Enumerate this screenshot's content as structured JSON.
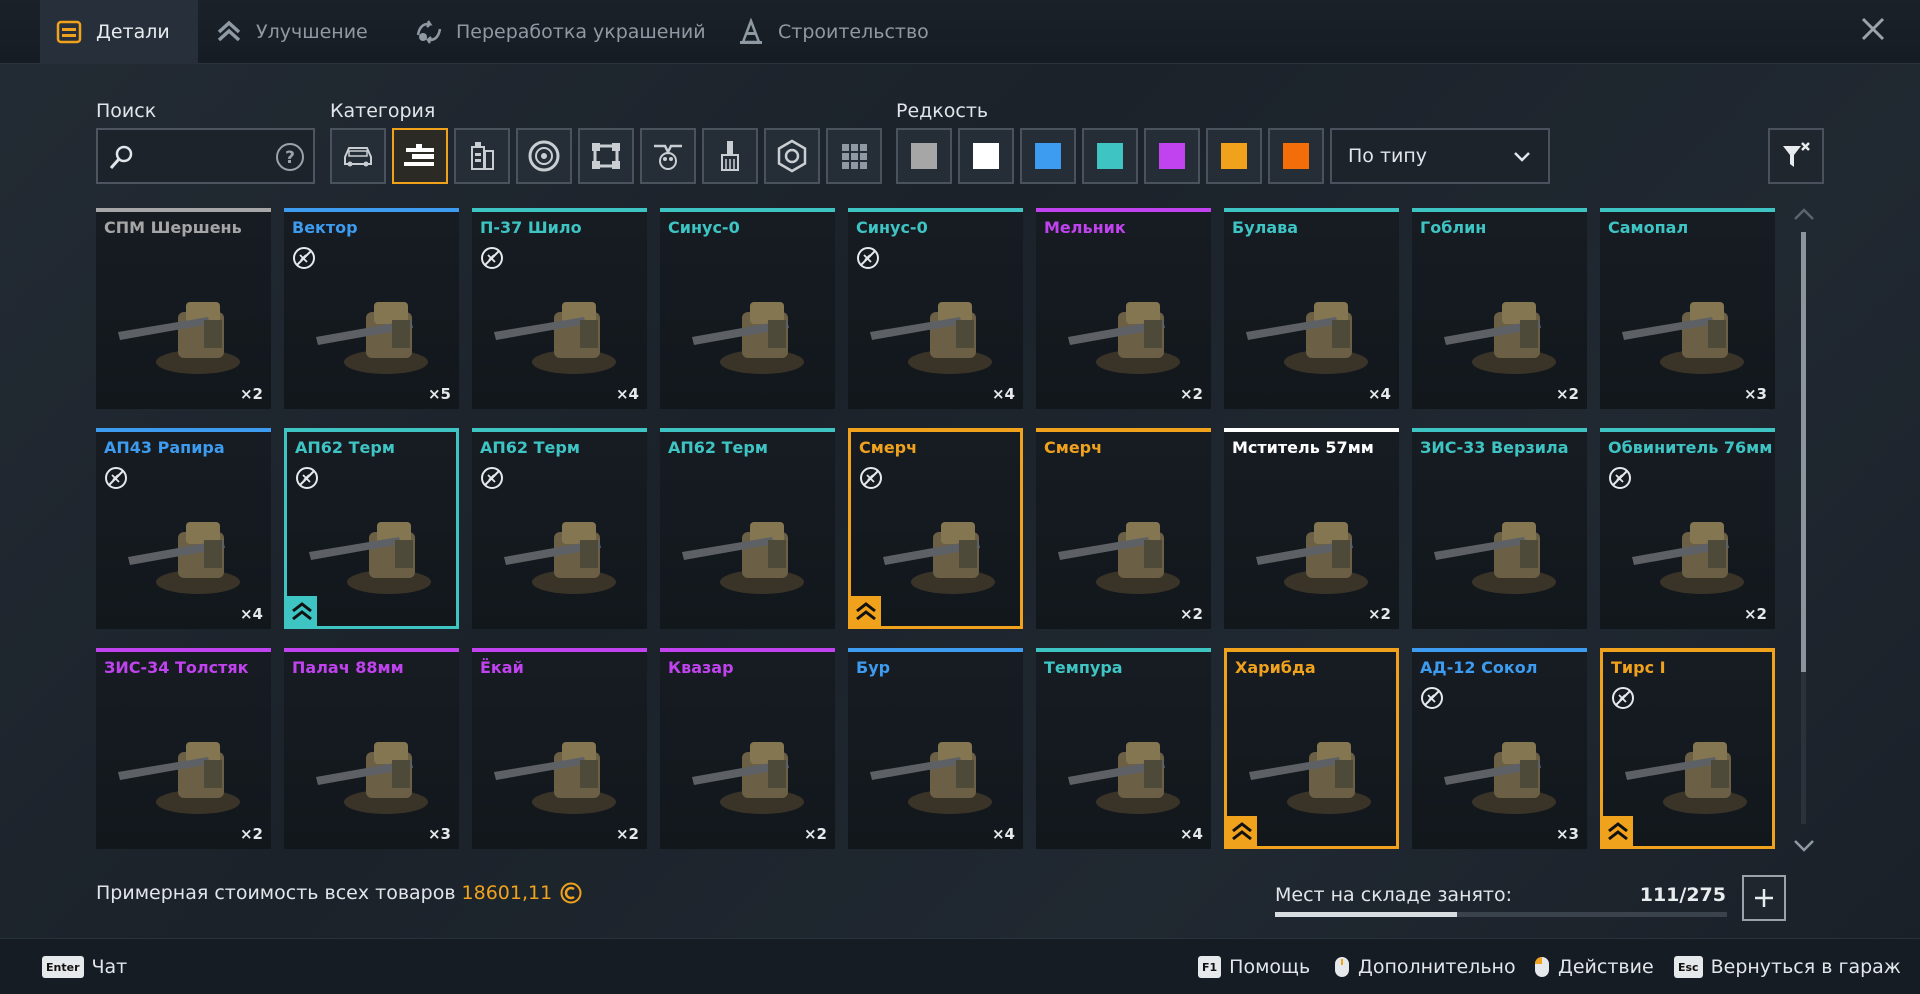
{
  "tabs": [
    {
      "label": "Детали",
      "icon": "parts-icon",
      "active": true
    },
    {
      "label": "Улучшение",
      "icon": "upgrade-icon",
      "active": false
    },
    {
      "label": "Переработка украшений",
      "icon": "recycle-icon",
      "active": false
    },
    {
      "label": "Строительство",
      "icon": "construction-icon",
      "active": false
    }
  ],
  "search": {
    "label": "Поиск",
    "value": "",
    "placeholder": ""
  },
  "category": {
    "label": "Категория",
    "buttons": [
      "cabins",
      "weapons",
      "modules",
      "movement",
      "frames",
      "decor",
      "paint",
      "structure",
      "all"
    ],
    "selected": "weapons"
  },
  "rarity": {
    "label": "Редкость",
    "colors": [
      "#a6a6a6",
      "#ffffff",
      "#3d9bf0",
      "#3fc4c4",
      "#c143ef",
      "#f0a21d",
      "#f36d0a"
    ]
  },
  "sort": {
    "value": "По типу"
  },
  "colors": {
    "common": "#a6a6a6",
    "regular": "#ffffff",
    "special": "#3d9bf0",
    "rare": "#3fc4c4",
    "epic": "#c143ef",
    "legendary": "#f0a21d",
    "relic": "#f36d0a"
  },
  "items": [
    {
      "name": "СПМ Шершень",
      "rarity": "common",
      "qty": "×2",
      "nocraft": false,
      "upgrade": false
    },
    {
      "name": "Вектор",
      "rarity": "special",
      "qty": "×5",
      "nocraft": true,
      "upgrade": false
    },
    {
      "name": "П-37 Шило",
      "rarity": "rare",
      "qty": "×4",
      "nocraft": true,
      "upgrade": false
    },
    {
      "name": "Синус-0",
      "rarity": "rare",
      "qty": "",
      "nocraft": false,
      "upgrade": false
    },
    {
      "name": "Синус-0",
      "rarity": "rare",
      "qty": "×4",
      "nocraft": true,
      "upgrade": false
    },
    {
      "name": "Мельник",
      "rarity": "epic",
      "qty": "×2",
      "nocraft": false,
      "upgrade": false
    },
    {
      "name": "Булава",
      "rarity": "rare",
      "qty": "×4",
      "nocraft": false,
      "upgrade": false
    },
    {
      "name": "Гоблин",
      "rarity": "rare",
      "qty": "×2",
      "nocraft": false,
      "upgrade": false
    },
    {
      "name": "Самопал",
      "rarity": "rare",
      "qty": "×3",
      "nocraft": false,
      "upgrade": false
    },
    {
      "name": "АП43 Рапира",
      "rarity": "special",
      "qty": "×4",
      "nocraft": true,
      "upgrade": false
    },
    {
      "name": "АП62 Терм",
      "rarity": "rare",
      "qty": "",
      "nocraft": true,
      "upgrade": true,
      "framed": true
    },
    {
      "name": "АП62 Терм",
      "rarity": "rare",
      "qty": "",
      "nocraft": true,
      "upgrade": false
    },
    {
      "name": "АП62 Терм",
      "rarity": "rare",
      "qty": "",
      "nocraft": false,
      "upgrade": false
    },
    {
      "name": "Смерч",
      "rarity": "legendary",
      "qty": "",
      "nocraft": true,
      "upgrade": true,
      "framed": true
    },
    {
      "name": "Смерч",
      "rarity": "legendary",
      "qty": "×2",
      "nocraft": false,
      "upgrade": false
    },
    {
      "name": "Мститель 57мм",
      "rarity": "regular",
      "qty": "×2",
      "nocraft": false,
      "upgrade": false
    },
    {
      "name": "ЗИС-33 Верзила",
      "rarity": "rare",
      "qty": "",
      "nocraft": false,
      "upgrade": false
    },
    {
      "name": "Обвинитель 76мм",
      "rarity": "rare",
      "qty": "×2",
      "nocraft": true,
      "upgrade": false
    },
    {
      "name": "ЗИС-34 Толстяк",
      "rarity": "epic",
      "qty": "×2",
      "nocraft": false,
      "upgrade": false
    },
    {
      "name": "Палач 88мм",
      "rarity": "epic",
      "qty": "×3",
      "nocraft": false,
      "upgrade": false
    },
    {
      "name": "Ёкай",
      "rarity": "epic",
      "qty": "×2",
      "nocraft": false,
      "upgrade": false
    },
    {
      "name": "Квазар",
      "rarity": "epic",
      "qty": "×2",
      "nocraft": false,
      "upgrade": false
    },
    {
      "name": "Бур",
      "rarity": "special",
      "qty": "×4",
      "nocraft": false,
      "upgrade": false
    },
    {
      "name": "Темпура",
      "rarity": "rare",
      "qty": "×4",
      "nocraft": false,
      "upgrade": false
    },
    {
      "name": "Харибда",
      "rarity": "legendary",
      "qty": "",
      "nocraft": false,
      "upgrade": true,
      "framed": true
    },
    {
      "name": "АД-12 Сокол",
      "rarity": "special",
      "qty": "×3",
      "nocraft": true,
      "upgrade": false
    },
    {
      "name": "Тирс I",
      "rarity": "legendary",
      "qty": "",
      "nocraft": true,
      "upgrade": true,
      "framed": true
    }
  ],
  "footer": {
    "cost_label": "Примерная стоимость всех товаров",
    "cost_value": "18601,11",
    "storage_label": "Мест на складе занято:",
    "storage_value": "111/275",
    "storage_fraction": 0.4036
  },
  "hints": [
    {
      "key": "Enter",
      "label": "Чат"
    },
    {
      "key": "F1",
      "label": "Помощь"
    },
    {
      "key": "mouse-middle",
      "label": "Дополнительно"
    },
    {
      "key": "mouse-left",
      "label": "Действие"
    },
    {
      "key": "Esc",
      "label": "Вернуться в гараж"
    }
  ]
}
